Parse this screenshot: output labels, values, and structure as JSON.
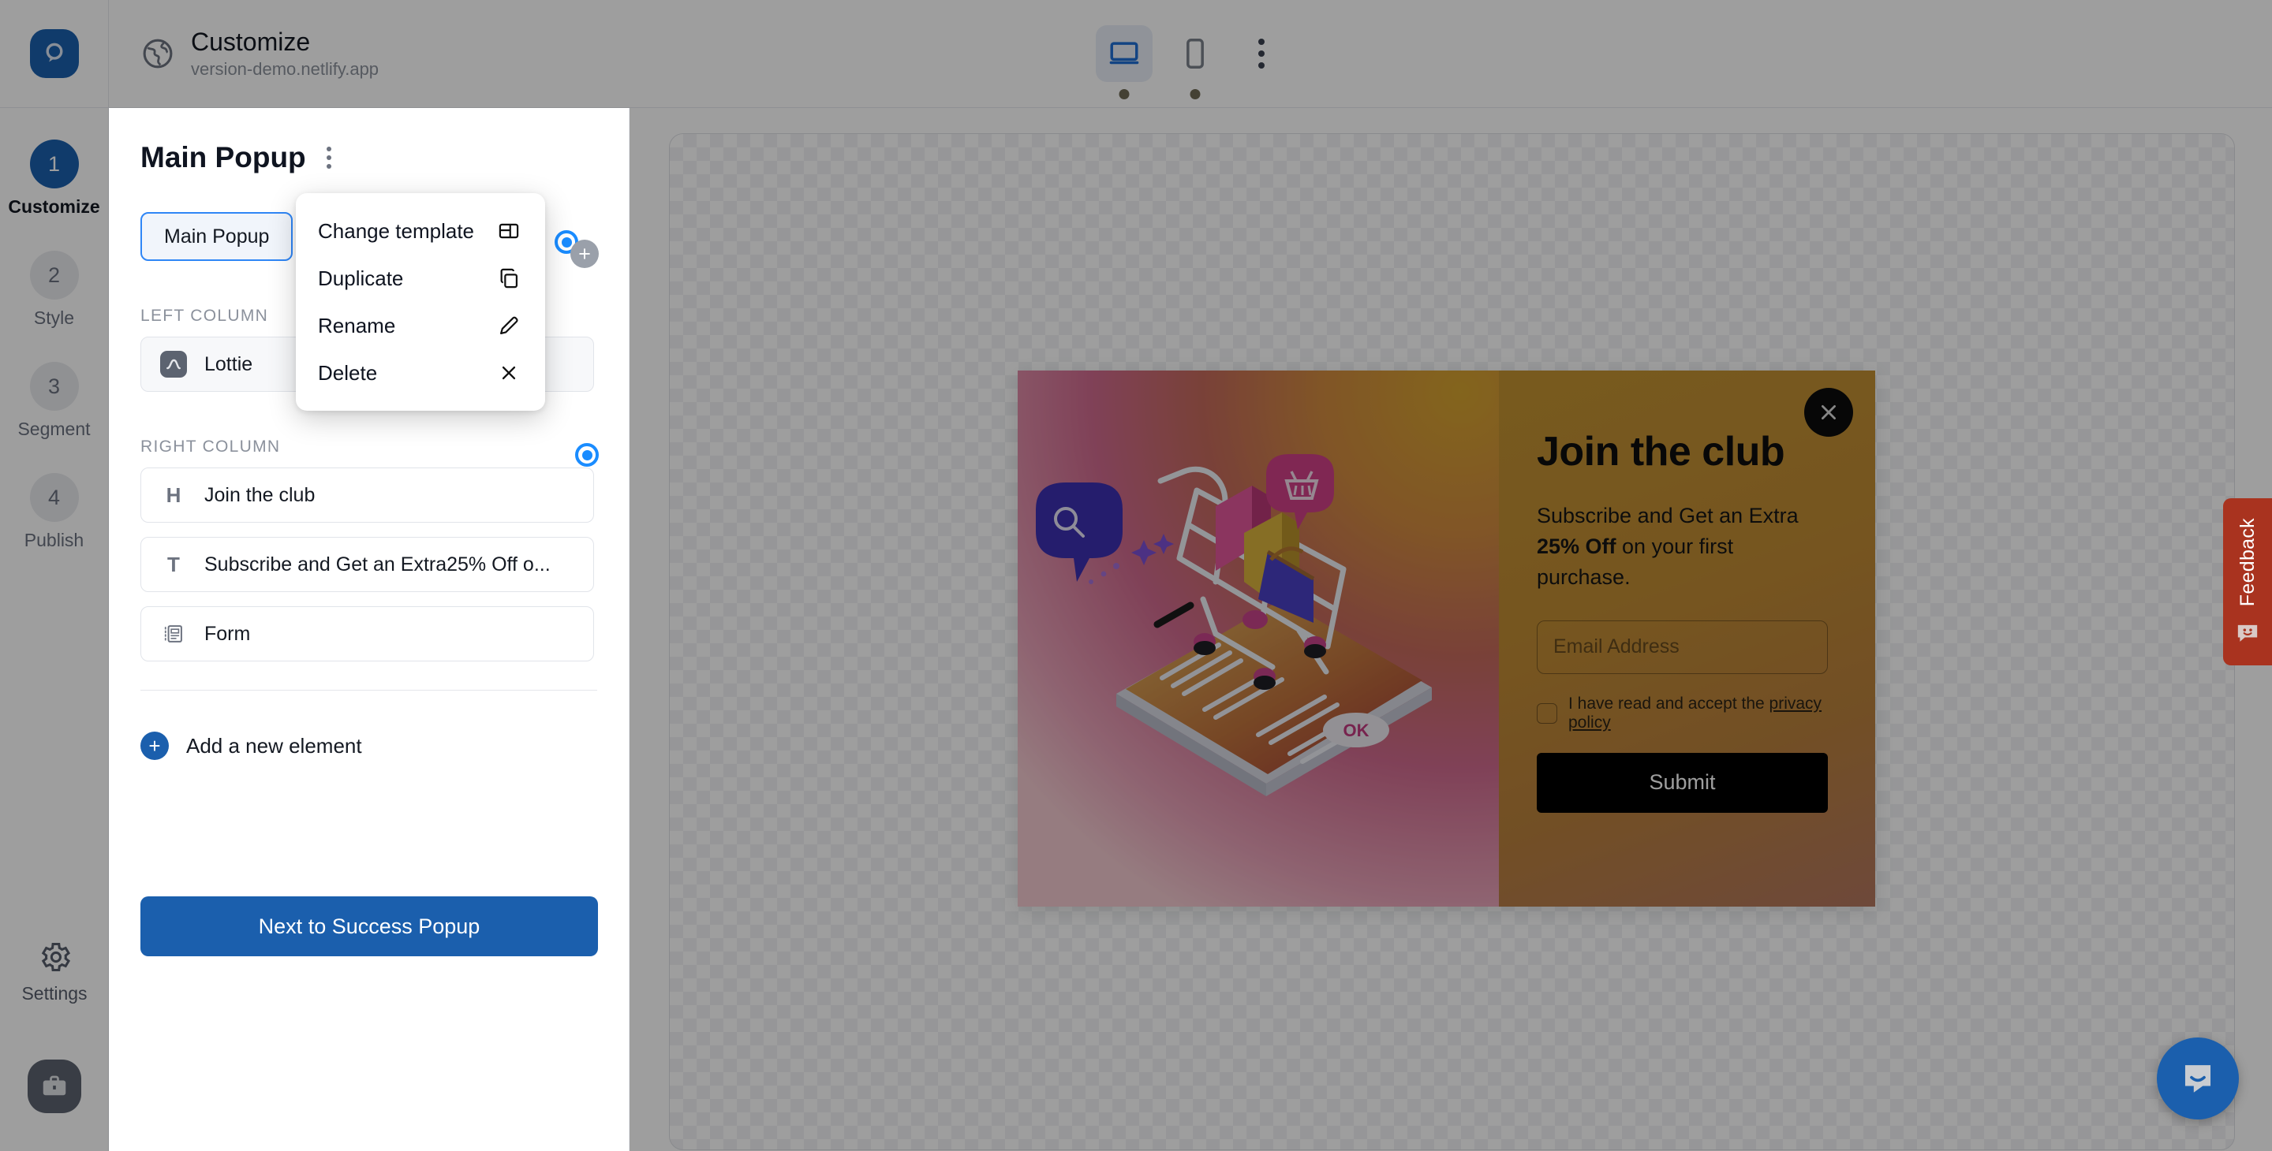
{
  "app": {
    "logo_icon": "optimonk-logo-icon"
  },
  "topbar": {
    "globe_icon": "globe-icon",
    "page_title": "Customize",
    "site_url": "version-demo.netlify.app",
    "devices": [
      {
        "id": "desktop",
        "icon": "desktop-icon",
        "selected": true
      },
      {
        "id": "mobile",
        "icon": "mobile-icon",
        "selected": false
      }
    ],
    "more_icon": "kebab-menu-icon"
  },
  "sidebar": {
    "steps": [
      {
        "number": "1",
        "label": "Customize",
        "active": true
      },
      {
        "number": "2",
        "label": "Style",
        "active": false
      },
      {
        "number": "3",
        "label": "Segment",
        "active": false
      },
      {
        "number": "4",
        "label": "Publish",
        "active": false
      }
    ],
    "settings": {
      "icon": "gear-icon",
      "label": "Settings"
    },
    "briefcase": {
      "icon": "briefcase-icon"
    }
  },
  "panel": {
    "title": "Main Popup",
    "kebab_icon": "kebab-menu-icon",
    "target_icon": "radio-target-icon",
    "add_icon": "plus-circle-icon",
    "tab": {
      "label": "Main Popup",
      "selected": true
    },
    "sections": [
      {
        "label": "LEFT COLUMN",
        "items": [
          {
            "icon": "lottie-icon",
            "icon_kind": "badge",
            "label": "Lottie",
            "selected": true
          }
        ]
      },
      {
        "label": "RIGHT COLUMN",
        "items": [
          {
            "icon": "heading-icon",
            "icon_kind": "letter",
            "icon_glyph": "H",
            "label": "Join the club",
            "selected": false
          },
          {
            "icon": "text-icon",
            "icon_kind": "letter",
            "icon_glyph": "T",
            "label": "Subscribe and Get an Extra25% Off o...",
            "selected": false
          },
          {
            "icon": "form-icon",
            "icon_kind": "svg",
            "label": "Form",
            "selected": false
          }
        ]
      }
    ],
    "add_element_label": "Add a new element",
    "next_button_label": "Next to Success Popup"
  },
  "context_menu": {
    "items": [
      {
        "label": "Change template",
        "icon": "template-layout-icon"
      },
      {
        "label": "Duplicate",
        "icon": "copy-icon"
      },
      {
        "label": "Rename",
        "icon": "pencil-icon"
      },
      {
        "label": "Delete",
        "icon": "close-x-icon"
      }
    ]
  },
  "preview": {
    "close_icon": "close-x-icon",
    "illustration_icon": "shopping-cart-phone-illustration",
    "title": "Join the club",
    "subtitle_lead": "Subscribe and Get an Extra",
    "subtitle_strong": "25% Off",
    "subtitle_tail": " on your first purchase.",
    "email_placeholder": "Email Address",
    "email_value": "",
    "consent_text": "I have read and accept the ",
    "consent_link": "privacy policy",
    "submit_label": "Submit"
  },
  "feedback": {
    "label": "Feedback",
    "icon": "smiley-chat-icon",
    "color": "#a9331f"
  },
  "intercom": {
    "icon": "intercom-chat-icon",
    "color": "#1b5fad"
  }
}
